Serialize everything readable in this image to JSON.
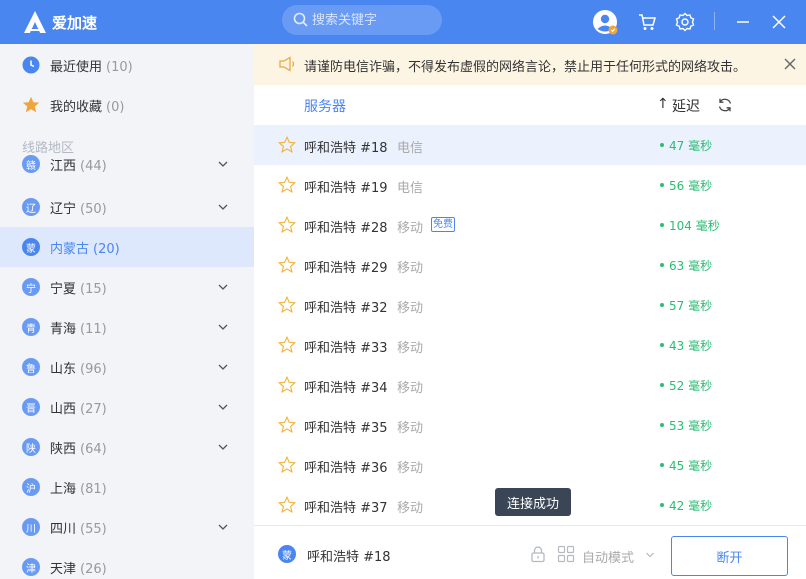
{
  "app": {
    "title": "爱加速"
  },
  "search": {
    "placeholder": "搜索关键字"
  },
  "titlebar_icons": [
    "user-avatar-icon",
    "cart-icon",
    "gear-icon",
    "minimize-icon",
    "close-icon"
  ],
  "sidebar": {
    "recent": {
      "label": "最近使用",
      "count": "(10)"
    },
    "favorites": {
      "label": "我的收藏",
      "count": "(0)"
    },
    "section_title": "线路地区",
    "regions": [
      {
        "badge": "赣",
        "label": "江西",
        "count": "(44)"
      },
      {
        "badge": "辽",
        "label": "辽宁",
        "count": "(50)"
      },
      {
        "badge": "蒙",
        "label": "内蒙古",
        "count": "(20)"
      },
      {
        "badge": "宁",
        "label": "宁夏",
        "count": "(15)"
      },
      {
        "badge": "青",
        "label": "青海",
        "count": "(11)"
      },
      {
        "badge": "鲁",
        "label": "山东",
        "count": "(96)"
      },
      {
        "badge": "晋",
        "label": "山西",
        "count": "(27)"
      },
      {
        "badge": "陕",
        "label": "陕西",
        "count": "(64)"
      },
      {
        "badge": "沪",
        "label": "上海",
        "count": "(81)"
      },
      {
        "badge": "川",
        "label": "四川",
        "count": "(55)"
      },
      {
        "badge": "津",
        "label": "天津",
        "count": "(26)"
      }
    ]
  },
  "notice": {
    "text": "请谨防电信诈骗，不得发布虚假的网络言论，禁止用于任何形式的网络攻击。"
  },
  "list_header": {
    "server": "服务器",
    "sort_arrow": "↑",
    "latency": "延迟"
  },
  "servers": [
    {
      "name": "呼和浩特 #18",
      "isp": "电信",
      "free": "",
      "latency": "47 毫秒"
    },
    {
      "name": "呼和浩特 #19",
      "isp": "电信",
      "free": "",
      "latency": "56 毫秒"
    },
    {
      "name": "呼和浩特 #28",
      "isp": "移动",
      "free": "免费",
      "latency": "104 毫秒"
    },
    {
      "name": "呼和浩特 #29",
      "isp": "移动",
      "free": "",
      "latency": "63 毫秒"
    },
    {
      "name": "呼和浩特 #32",
      "isp": "移动",
      "free": "",
      "latency": "57 毫秒"
    },
    {
      "name": "呼和浩特 #33",
      "isp": "移动",
      "free": "",
      "latency": "43 毫秒"
    },
    {
      "name": "呼和浩特 #34",
      "isp": "移动",
      "free": "",
      "latency": "52 毫秒"
    },
    {
      "name": "呼和浩特 #35",
      "isp": "移动",
      "free": "",
      "latency": "53 毫秒"
    },
    {
      "name": "呼和浩特 #36",
      "isp": "移动",
      "free": "",
      "latency": "45 毫秒"
    },
    {
      "name": "呼和浩特 #37",
      "isp": "移动",
      "free": "",
      "latency": "42 毫秒"
    }
  ],
  "tooltip": {
    "text": "连接成功"
  },
  "bottom": {
    "badge": "蒙",
    "current_server": "呼和浩特 #18",
    "mode": "自动模式",
    "disconnect": "断开"
  },
  "colors": {
    "accent": "#4a86f0",
    "latency": "#2bbd73",
    "notice_bg": "#fdf5e3",
    "star": "#f0b23c"
  }
}
